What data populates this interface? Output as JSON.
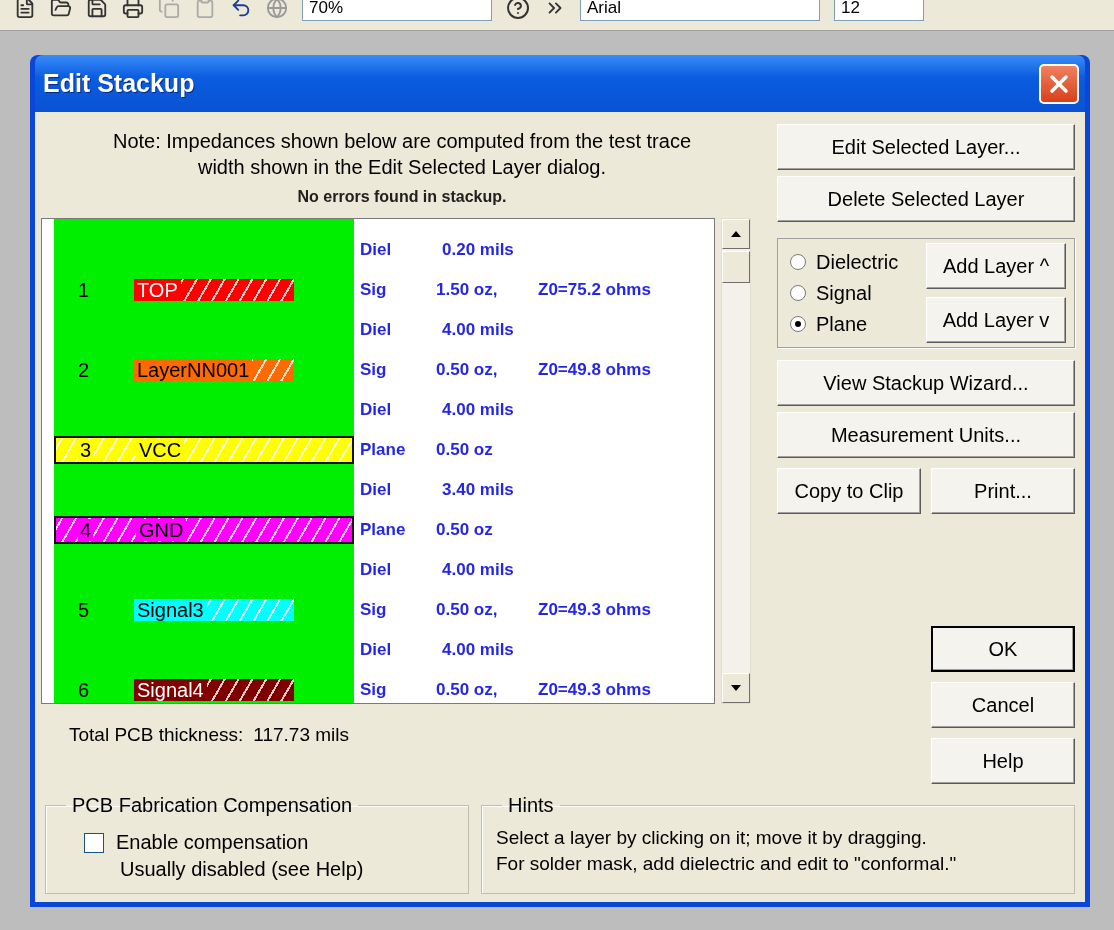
{
  "window": {
    "title": "Edit Stackup"
  },
  "toolbar": {
    "zoom": "70%",
    "font": "Arial",
    "size": "12"
  },
  "note": [
    "Note: Impedances shown below are computed from the test trace",
    "width shown in the Edit Selected Layer dialog."
  ],
  "status": "No errors found in stackup.",
  "stackup": [
    {
      "kind": "diel",
      "type": "Diel",
      "value": "0.20 mils"
    },
    {
      "kind": "sig",
      "number": "1",
      "name": "TOP",
      "color": "#ff0000",
      "type": "Sig",
      "value": "1.50 oz,",
      "impedance": "Z0=75.2 ohms"
    },
    {
      "kind": "diel",
      "type": "Diel",
      "value": "4.00 mils"
    },
    {
      "kind": "sig",
      "number": "2",
      "name": "LayerNN001",
      "color": "#ff6a00",
      "type": "Sig",
      "value": "0.50 oz,",
      "impedance": "Z0=49.8 ohms"
    },
    {
      "kind": "diel",
      "type": "Diel",
      "value": "4.00 mils"
    },
    {
      "kind": "plane",
      "number": "3",
      "name": "VCC",
      "color": "#ffff00",
      "type": "Plane",
      "value": "0.50 oz"
    },
    {
      "kind": "diel",
      "type": "Diel",
      "value": "3.40 mils"
    },
    {
      "kind": "plane",
      "number": "4",
      "name": "GND",
      "color": "#ff00ff",
      "type": "Plane",
      "value": "0.50 oz"
    },
    {
      "kind": "diel",
      "type": "Diel",
      "value": "4.00 mils"
    },
    {
      "kind": "sig",
      "number": "5",
      "name": "Signal3",
      "color": "#00ffff",
      "type": "Sig",
      "value": "0.50 oz,",
      "impedance": "Z0=49.3 ohms"
    },
    {
      "kind": "diel",
      "type": "Diel",
      "value": "4.00 mils"
    },
    {
      "kind": "sig",
      "number": "6",
      "name": "Signal4",
      "color": "#800000",
      "type": "Sig",
      "value": "0.50 oz,",
      "impedance": "Z0=49.3 ohms"
    }
  ],
  "total_thickness": {
    "label": "Total PCB thickness:",
    "value": "117.73 mils"
  },
  "actions": [
    "Edit Selected Layer...",
    "Delete Selected Layer"
  ],
  "layer_types": [
    {
      "label": "Dielectric",
      "selected": false
    },
    {
      "label": "Signal",
      "selected": false
    },
    {
      "label": "Plane",
      "selected": true
    }
  ],
  "add_buttons": [
    "Add Layer ^",
    "Add Layer v"
  ],
  "tools": [
    "View Stackup Wizard...",
    "Measurement Units..."
  ],
  "clip_buttons": [
    "Copy to Clip",
    "Print..."
  ],
  "dialog_buttons": [
    {
      "label": "OK",
      "default": true
    },
    {
      "label": "Cancel",
      "default": false
    },
    {
      "label": "Help",
      "default": false
    }
  ],
  "compensation": {
    "title": "PCB Fabrication Compensation",
    "checkbox": {
      "label": "Enable compensation",
      "checked": false
    },
    "note": "Usually disabled (see Help)"
  },
  "hints": {
    "title": "Hints",
    "lines": [
      "Select a layer by clicking on it; move it by dragging.",
      "For solder mask, add dielectric and edit to \"conformal.\""
    ]
  }
}
